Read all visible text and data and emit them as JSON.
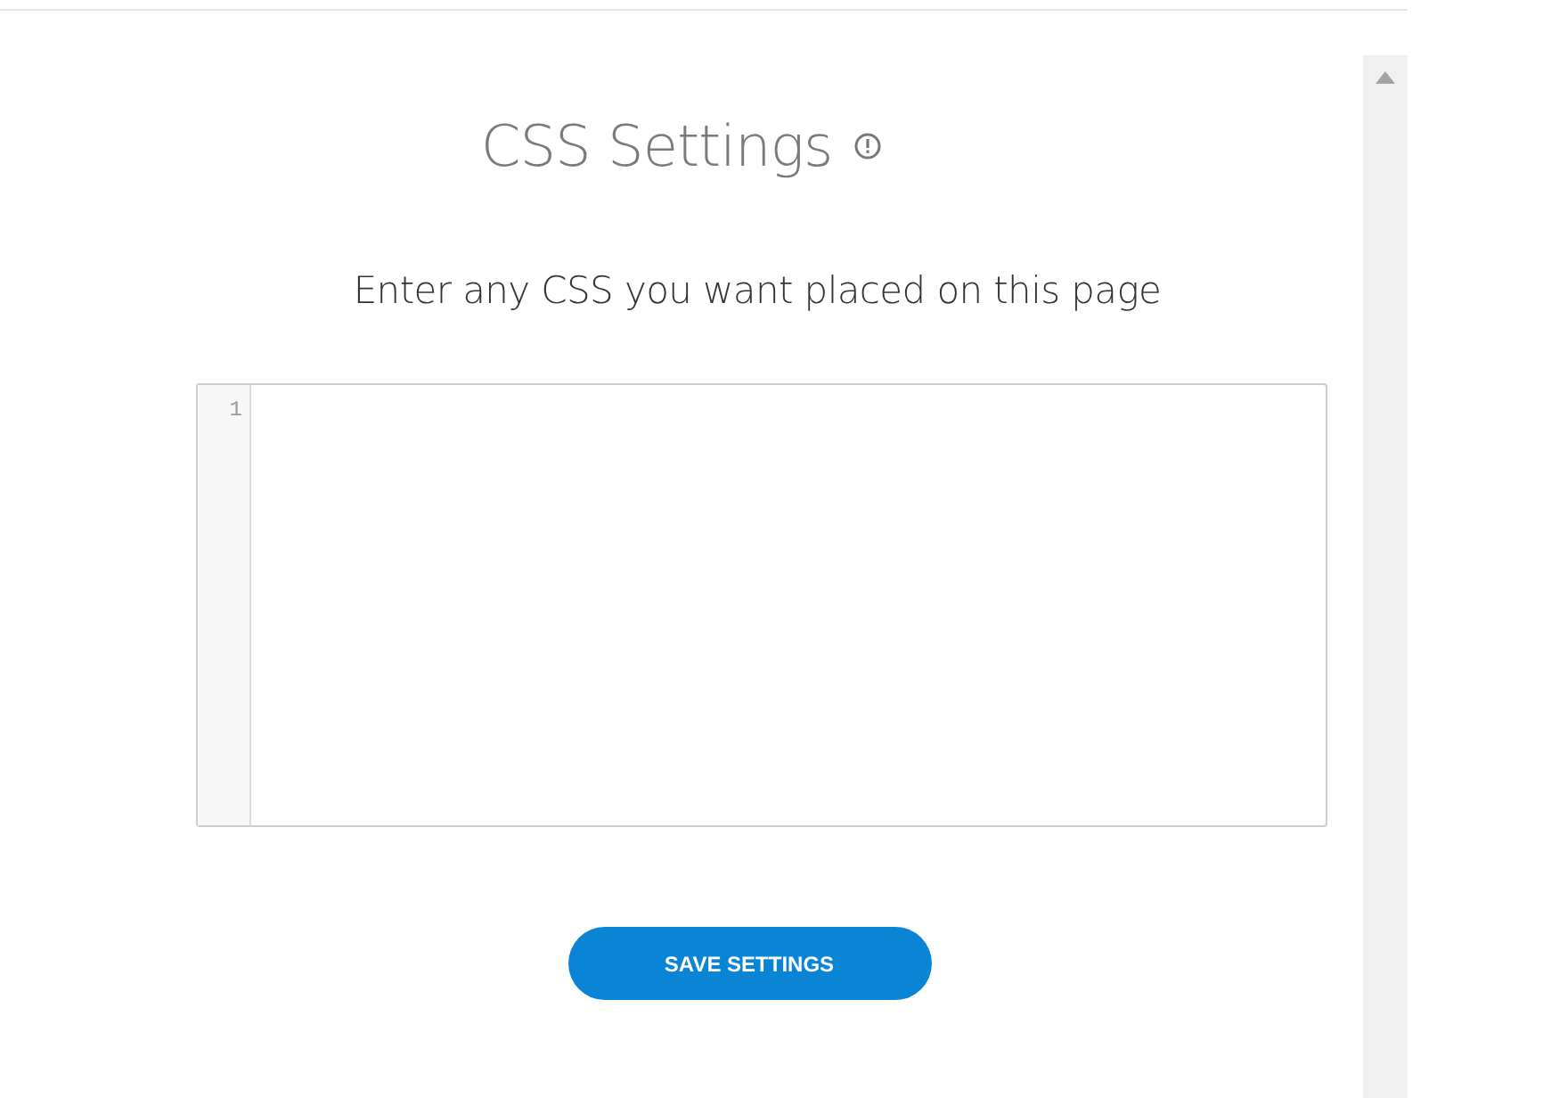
{
  "title": "CSS Settings",
  "subtitle": "Enter any CSS you want placed on this page",
  "editor": {
    "line_numbers": [
      "1"
    ]
  },
  "save_button": "SAVE SETTINGS"
}
